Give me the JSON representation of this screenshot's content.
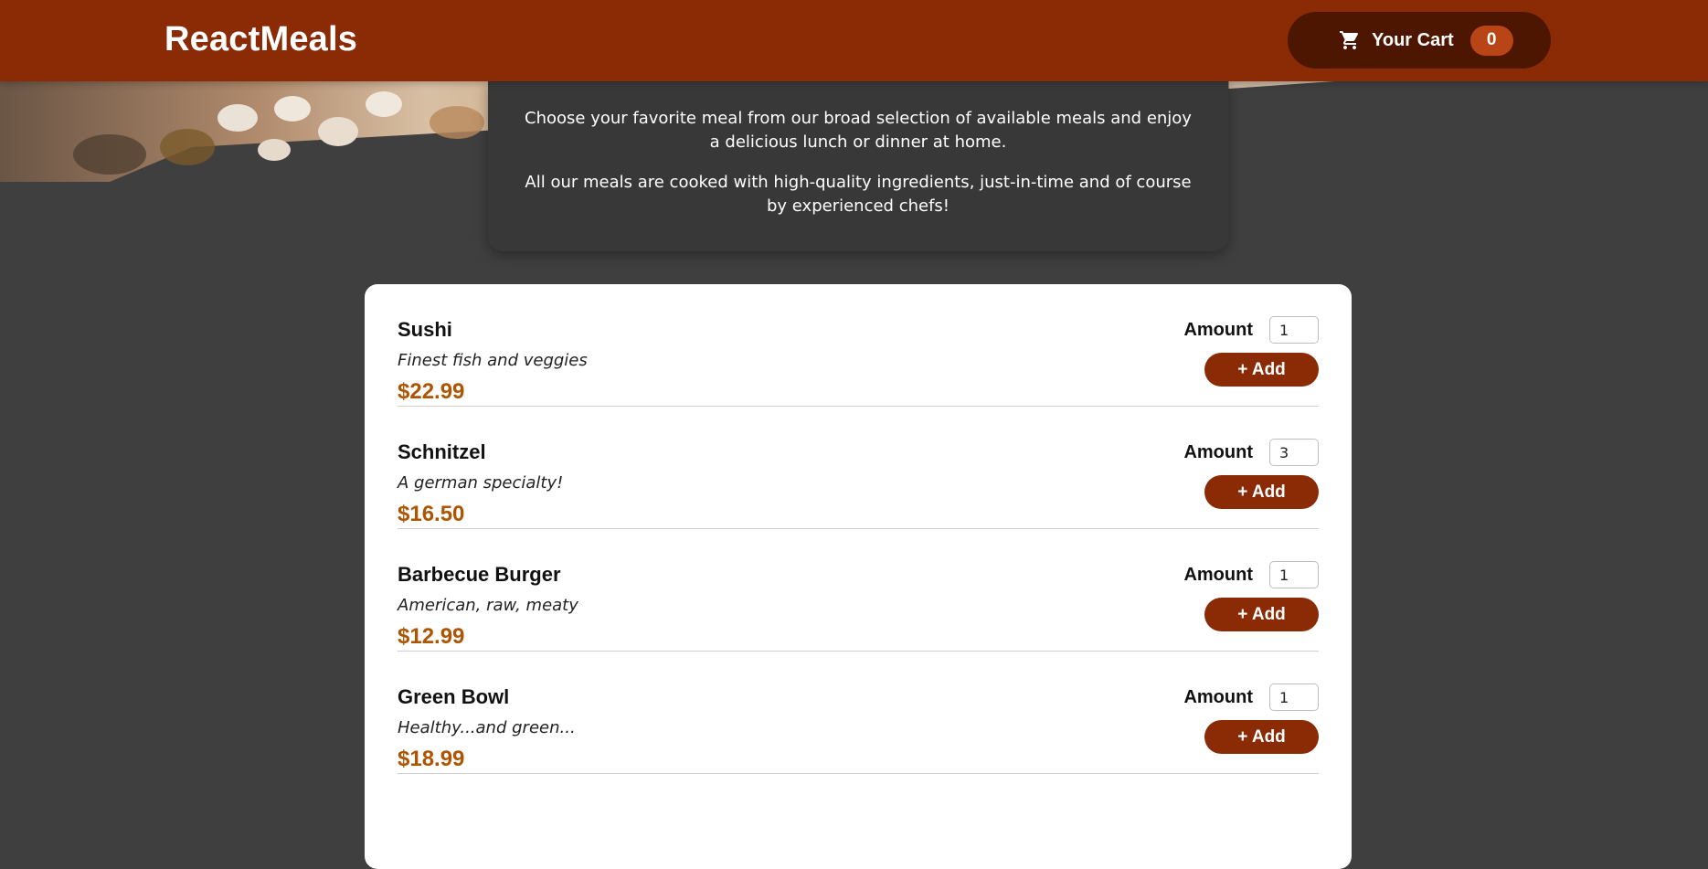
{
  "header": {
    "brand": "ReactMeals",
    "cart": {
      "icon": "cart-icon",
      "label": "Your Cart",
      "count": "0"
    }
  },
  "summary": {
    "paragraphs": [
      "Choose your favorite meal from our broad selection of available meals and enjoy a delicious lunch or dinner at home.",
      "All our meals are cooked with high-quality ingredients, just-in-time and of course by experienced chefs!"
    ]
  },
  "meals": {
    "amount_label": "Amount",
    "add_label": "+ Add",
    "items": [
      {
        "name": "Sushi",
        "description": "Finest fish and veggies",
        "price": "$22.99",
        "amount": "1"
      },
      {
        "name": "Schnitzel",
        "description": "A german specialty!",
        "price": "$16.50",
        "amount": "3"
      },
      {
        "name": "Barbecue Burger",
        "description": "American, raw, meaty",
        "price": "$12.99",
        "amount": "1"
      },
      {
        "name": "Green Bowl",
        "description": "Healthy...and green...",
        "price": "$18.99",
        "amount": "1"
      }
    ]
  },
  "colors": {
    "header": "#8a2b06",
    "cart_button": "#4d1601",
    "badge": "#b94517",
    "price": "#ad5502",
    "page_background": "#3f3f3f"
  }
}
